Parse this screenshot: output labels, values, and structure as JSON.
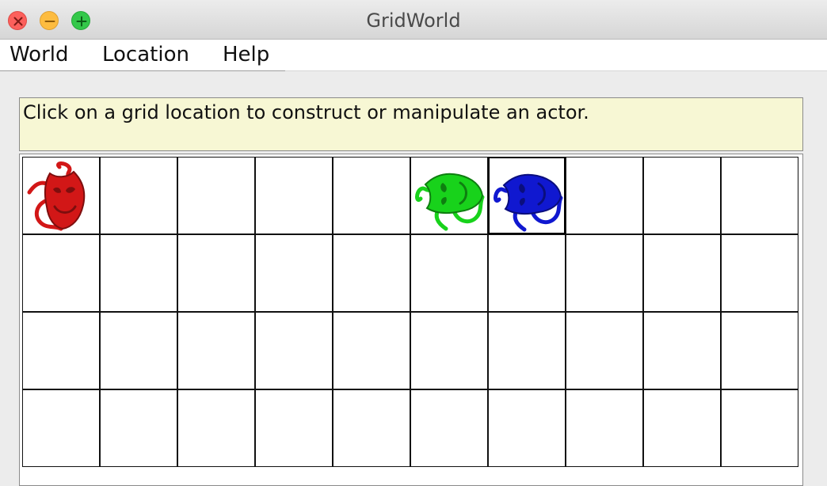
{
  "window": {
    "title": "GridWorld"
  },
  "menu": {
    "items": [
      "World",
      "Location",
      "Help"
    ]
  },
  "message": "Click on a grid location to construct or manipulate an actor.",
  "grid": {
    "visible_rows": 4,
    "columns": 10,
    "selected": {
      "row": 0,
      "col": 6
    },
    "actors": [
      {
        "type": "bug",
        "row": 0,
        "col": 0,
        "color": "#d21717",
        "direction": "north"
      },
      {
        "type": "bug",
        "row": 0,
        "col": 5,
        "color": "#18d21b",
        "direction": "west"
      },
      {
        "type": "bug",
        "row": 0,
        "col": 6,
        "color": "#1018d0",
        "direction": "west"
      }
    ]
  },
  "colors": {
    "message_bg": "#f7f7d4",
    "close": "#fc605c",
    "minimize": "#fdbc40",
    "maximize": "#34c84a"
  }
}
